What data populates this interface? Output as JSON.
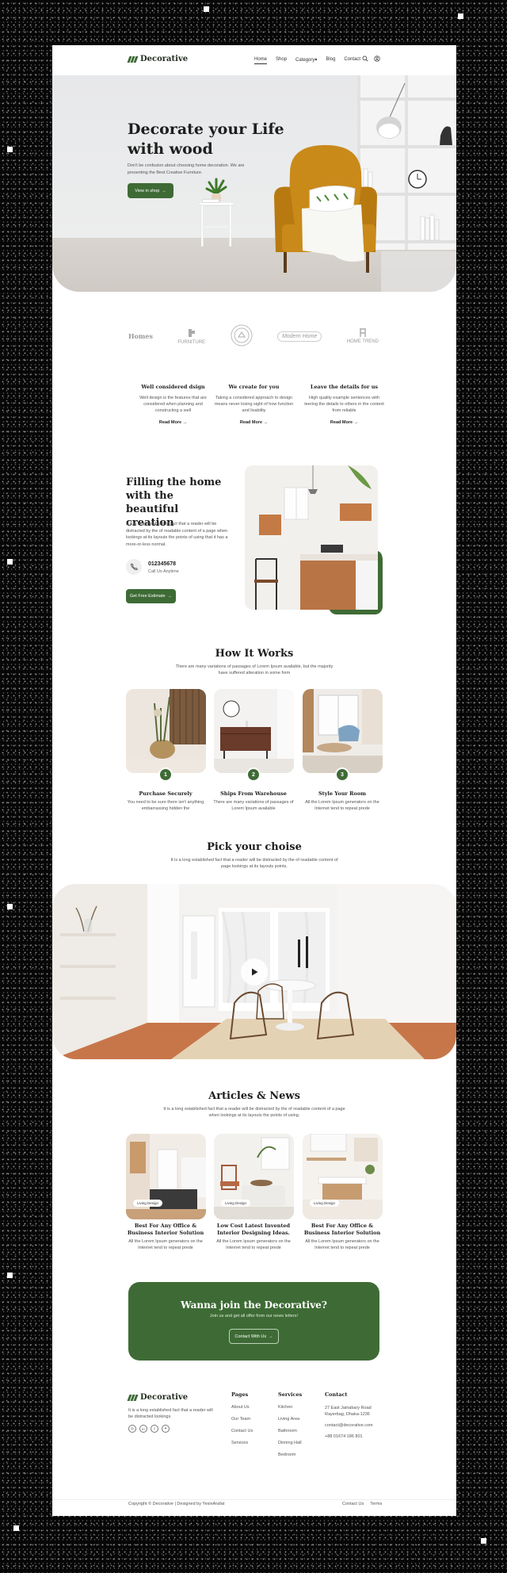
{
  "nav": {
    "brand": "Decorative",
    "links": [
      "Home",
      "Shop",
      "Category",
      "Blog",
      "Contact"
    ]
  },
  "hero": {
    "title": "Decorate your Life with wood",
    "subtitle": "Don't be confusion about choosing home decoration. We are presenting the Best Creative Furniture.",
    "cta": "View in shop"
  },
  "brands": [
    "Homes",
    "FURNITURE",
    "",
    "Modern Home",
    "HOME TREND"
  ],
  "features": [
    {
      "title": "Well considered dsign",
      "text": "Well design is the features that are considered when planning and constructing a well",
      "link": "Read More"
    },
    {
      "title": "We create for you",
      "text": "Taking a considered approach to design means never losing sight of how function and livability",
      "link": "Read More"
    },
    {
      "title": "Leave the details for us",
      "text": "High quality example sentences with teering the details to others in the context from reliable",
      "link": "Read More"
    }
  ],
  "filling": {
    "title": "Filling the home with the beautiful creation",
    "text": "It is a long established fact that a reader will be distracted by the of readable content of a page when lookings at its layouts the points of using that it has a more-or-less normal.",
    "phone": "012345678",
    "phone_label": "Call Us Anytime",
    "cta": "Get Free Estimate"
  },
  "how": {
    "title": "How It Works",
    "subtitle": "There are many variations of passages of Lorem Ipsum available, but the majority have suffered alteration in some form",
    "steps": [
      {
        "num": "1",
        "title": "Purchase Securely",
        "text": "You need to be sure there isn't anything embarrassing hidden the"
      },
      {
        "num": "2",
        "title": "Ships From Warehouse",
        "text": "There are many variations of passages of Lorem Ipsum available"
      },
      {
        "num": "3",
        "title": "Style Your Room",
        "text": "All the Lorem Ipsum generators on the Internet tend to repeat prede"
      }
    ]
  },
  "pick": {
    "title": "Pick your choise",
    "subtitle": "It is a long established fact that a reader will be distracted by the of readable content of page lookings at its layouts points."
  },
  "articles": {
    "title": "Articles & News",
    "subtitle": "It is a long established fact that a reader will be distracted by the of readable content of a page when lookings at its layouts the points of using.",
    "items": [
      {
        "tag": "Living Design",
        "title": "Best For Any Office & Business Interior Solution",
        "text": "All the Lorem Ipsum generators on the Internet tend to repeat prede"
      },
      {
        "tag": "Living Design",
        "title": "Low Cost Latest Invented Interior Designing Ideas.",
        "text": "All the Lorem Ipsum generators on the Internet tend to repeat prede"
      },
      {
        "tag": "Living Design",
        "title": "Best For Any Office & Business Interior Solution",
        "text": "All the Lorem Ipsum generators on the Internet tend to repeat prede"
      }
    ]
  },
  "cta": {
    "title": "Wanna join the Decorative?",
    "subtitle": "Join us and get all offer from our news letters!",
    "button": "Contact With Us"
  },
  "footer": {
    "brand": "Decorative",
    "desc": "It is a long established fact that a reader will be distracted lookings.",
    "pages_title": "Pages",
    "pages": [
      "About Us",
      "Our Team",
      "Contact Us",
      "Services"
    ],
    "services_title": "Services",
    "services": [
      "Kitchen",
      "Living Area",
      "Bathroom",
      "Dinning Hall",
      "Bedroom"
    ],
    "contact_title": "Contact",
    "address": "27 East Jainabary Road Rayerbag, Dhaka-1236",
    "email": "contact@decorative.com",
    "phone": "+88 01674 186 801",
    "copyright": "Copyright © Decorative | Designed by YesinArafat",
    "legal": [
      "Contact Us",
      "Terms"
    ]
  },
  "colors": {
    "accent": "#3e6b35",
    "chair": "#c98a1a",
    "background": "#ffffff"
  }
}
